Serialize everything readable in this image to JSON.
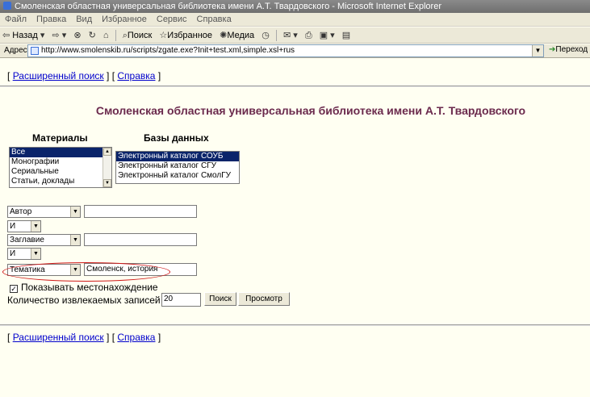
{
  "window": {
    "title": "Смоленская областная универсальная библиотека имени А.Т. Твардовского - Microsoft Internet Explorer"
  },
  "menu": [
    "Файл",
    "Правка",
    "Вид",
    "Избранное",
    "Сервис",
    "Справка"
  ],
  "toolbar": {
    "back": "Назад",
    "search": "Поиск",
    "favorites": "Избранное",
    "media": "Медиа"
  },
  "address": {
    "label": "Адрес:",
    "url": "http://www.smolenskib.ru/scripts/zgate.exe?Init+test.xml,simple.xsl+rus",
    "go": "Переход"
  },
  "page": {
    "top_links": {
      "open": "[",
      "advanced": "Расширенный поиск",
      "mid": "] [",
      "help": "Справка",
      "close": "]"
    },
    "bottom_links": {
      "open": "[",
      "advanced": "Расширенный поиск",
      "mid": "] [",
      "help": "Справка",
      "close": "]"
    },
    "title": "Смоленская областная универсальная библиотека имени А.Т. Твардовского",
    "materials": {
      "heading": "Материалы",
      "options": [
        "Все",
        "Монографии",
        "Сериальные",
        "Статьи, доклады"
      ]
    },
    "databases": {
      "heading": "Базы данных",
      "options": [
        "Электронный каталог СОУБ",
        "Электронный каталог СГУ",
        "Электронный каталог СмолГУ"
      ]
    },
    "search_rows": [
      {
        "field": "Автор",
        "value": ""
      },
      {
        "operator": "И"
      },
      {
        "field": "Заглавие",
        "value": ""
      },
      {
        "operator": "И"
      },
      {
        "field": "Тематика",
        "value": "Смоленск, история"
      }
    ],
    "show_location": "Показывать местонахождение",
    "show_location_checked": true,
    "records_label": "Количество извлекаемых записей",
    "records_value": "20",
    "search_button": "Поиск",
    "view_button": "Просмотр"
  },
  "colors": {
    "title_text": "#6b2a4d",
    "selection": "#0a246a",
    "annotation_ellipse": "#d01818"
  }
}
